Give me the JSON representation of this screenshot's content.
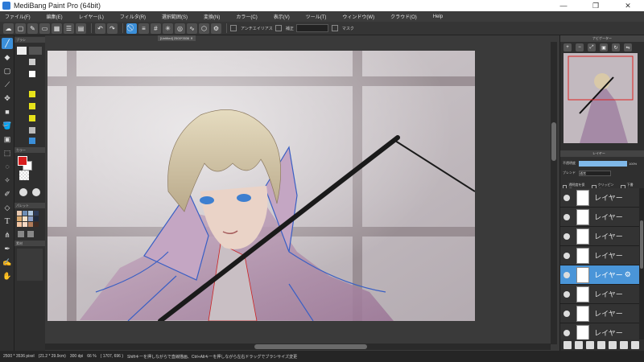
{
  "window": {
    "title": "MediBang Paint Pro (64bit)",
    "minimize": "—",
    "maximize": "❐",
    "close": "✕"
  },
  "menu": [
    "ファイル(F)",
    "編集(E)",
    "レイヤー(L)",
    "フィルタ(R)",
    "選択範囲(S)",
    "変換(N)",
    "カラー(C)",
    "表示(V)",
    "ツール(T)",
    "ウィンドウ(W)",
    "クラウド(O)",
    "Help"
  ],
  "toolbar": {
    "undo": "↶",
    "redo": "↷",
    "antialias_label": "アンチエイリアス",
    "snap_label": "補正",
    "snap_value": "",
    "toggle_label": "マスク"
  },
  "document_tab": "[Untitled] 2500*3536 ✕",
  "left_panel": {
    "brush_head": "ブラシ",
    "color_head": "カラー",
    "palette_head": "パレット",
    "material_head": "素材"
  },
  "navigator": {
    "title": "ナビゲーター"
  },
  "layer_panel": {
    "title": "レイヤー",
    "opacity_label": "不透明度",
    "opacity_value": "100%",
    "opacity_fraction": 1.0,
    "blend_label": "ブレンド",
    "blend_value": "通常",
    "protect_label": "透明度を保護",
    "clip_label": "クリッピング",
    "draft_label": "下書き",
    "layers": [
      {
        "name": "レイヤー",
        "selected": false
      },
      {
        "name": "レイヤー",
        "selected": false
      },
      {
        "name": "レイヤー",
        "selected": false
      },
      {
        "name": "レイヤー",
        "selected": false
      },
      {
        "name": "レイヤー",
        "selected": true
      },
      {
        "name": "レイヤー",
        "selected": false
      },
      {
        "name": "レイヤー",
        "selected": false
      },
      {
        "name": "レイヤー",
        "selected": false
      }
    ]
  },
  "status": {
    "size": "2500 * 3536 pixel",
    "physical": "(21.2 * 29.9cm)",
    "dpi": "300 dpi",
    "zoom": "66 %",
    "coords": "( 1707, 696 )",
    "hint": "Shiftキーを押しながらで直線描画、Ctrl+Altキーを押しながら左右ドラッグでブラシサイズ変更"
  },
  "colors": {
    "accent": "#3b8fd9",
    "foreground": "#d81e1e",
    "background": "#ffffff"
  }
}
